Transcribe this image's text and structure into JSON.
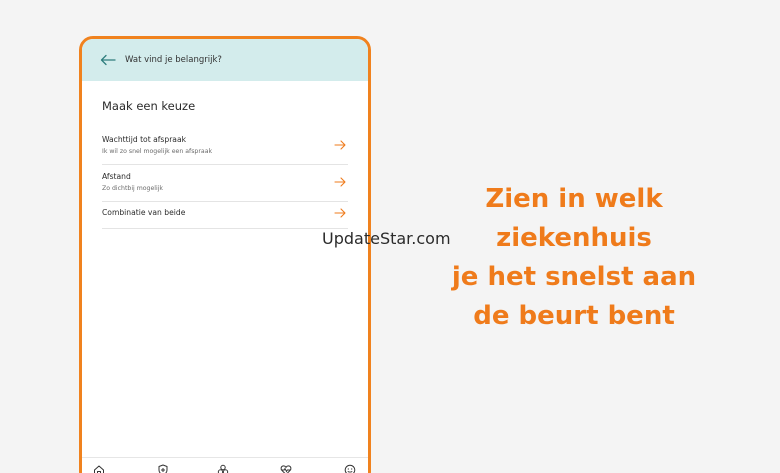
{
  "app": {
    "header_title": "Wat vind je belangrijk?",
    "section_title": "Maak een keuze",
    "choices": [
      {
        "label": "Wachttijd tot afspraak",
        "sub": "Ik wil zo snel mogelijk een afspraak"
      },
      {
        "label": "Afstand",
        "sub": "Zo dichtbij mogelijk"
      },
      {
        "label": "Combinatie van beide",
        "sub": ""
      }
    ],
    "nav_icons": [
      "home-icon",
      "shield-plus-icon",
      "circles-icon",
      "heart-pulse-icon",
      "smiley-icon"
    ]
  },
  "promo": {
    "line1": "Zien in welk ziekenhuis",
    "line2": "je het snelst aan",
    "line3": "de beurt bent"
  },
  "watermark": "UpdateStar.com",
  "colors": {
    "accent": "#ef7b1b",
    "header_bg": "#d3ecec",
    "background": "#f4f4f4"
  }
}
